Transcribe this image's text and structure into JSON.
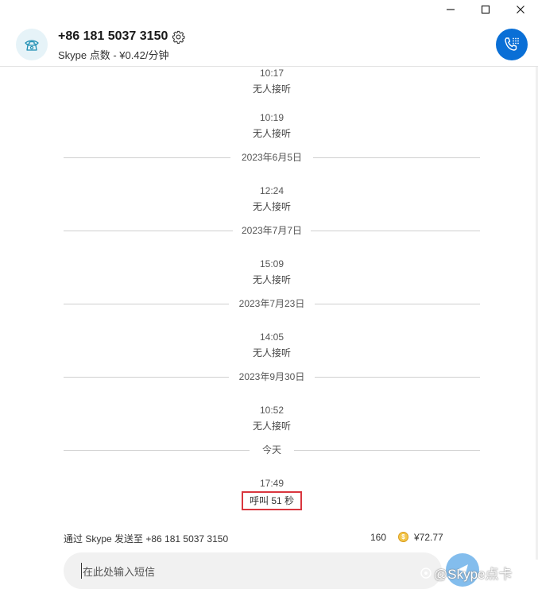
{
  "window": {
    "minimize_glyph": "—",
    "maximize_glyph": "☐",
    "close_glyph": "✕"
  },
  "header": {
    "contact_number": "+86 181 5037 3150",
    "rate_text": "Skype 点数 - ¥0.42/分钟",
    "avatar_icon": "telephone-icon",
    "settings_icon": "gear-icon",
    "call_icon": "phone-dialpad-icon"
  },
  "call_log": [
    {
      "time": "10:17",
      "status": "无人接听"
    },
    {
      "time": "10:19",
      "status": "无人接听"
    },
    {
      "date": "2023年6月5日"
    },
    {
      "time": "12:24",
      "status": "无人接听"
    },
    {
      "date": "2023年7月7日"
    },
    {
      "time": "15:09",
      "status": "无人接听"
    },
    {
      "date": "2023年7月23日"
    },
    {
      "time": "14:05",
      "status": "无人接听"
    },
    {
      "date": "2023年9月30日"
    },
    {
      "time": "10:52",
      "status": "无人接听"
    },
    {
      "date": "今天"
    },
    {
      "time": "17:49",
      "status": "呼叫 51 秒"
    }
  ],
  "footer": {
    "send_info": "通过 Skype 发送至 +86 181 5037 3150",
    "sms_credits": "160",
    "coin_symbol": "$",
    "balance": "¥72.77",
    "input_placeholder": "在此处输入短信",
    "watermark": "@Skype点卡"
  },
  "colors": {
    "accent": "#0a6fd6",
    "highlight_border": "#d9363e",
    "composer_bg": "#f1f1f1"
  }
}
